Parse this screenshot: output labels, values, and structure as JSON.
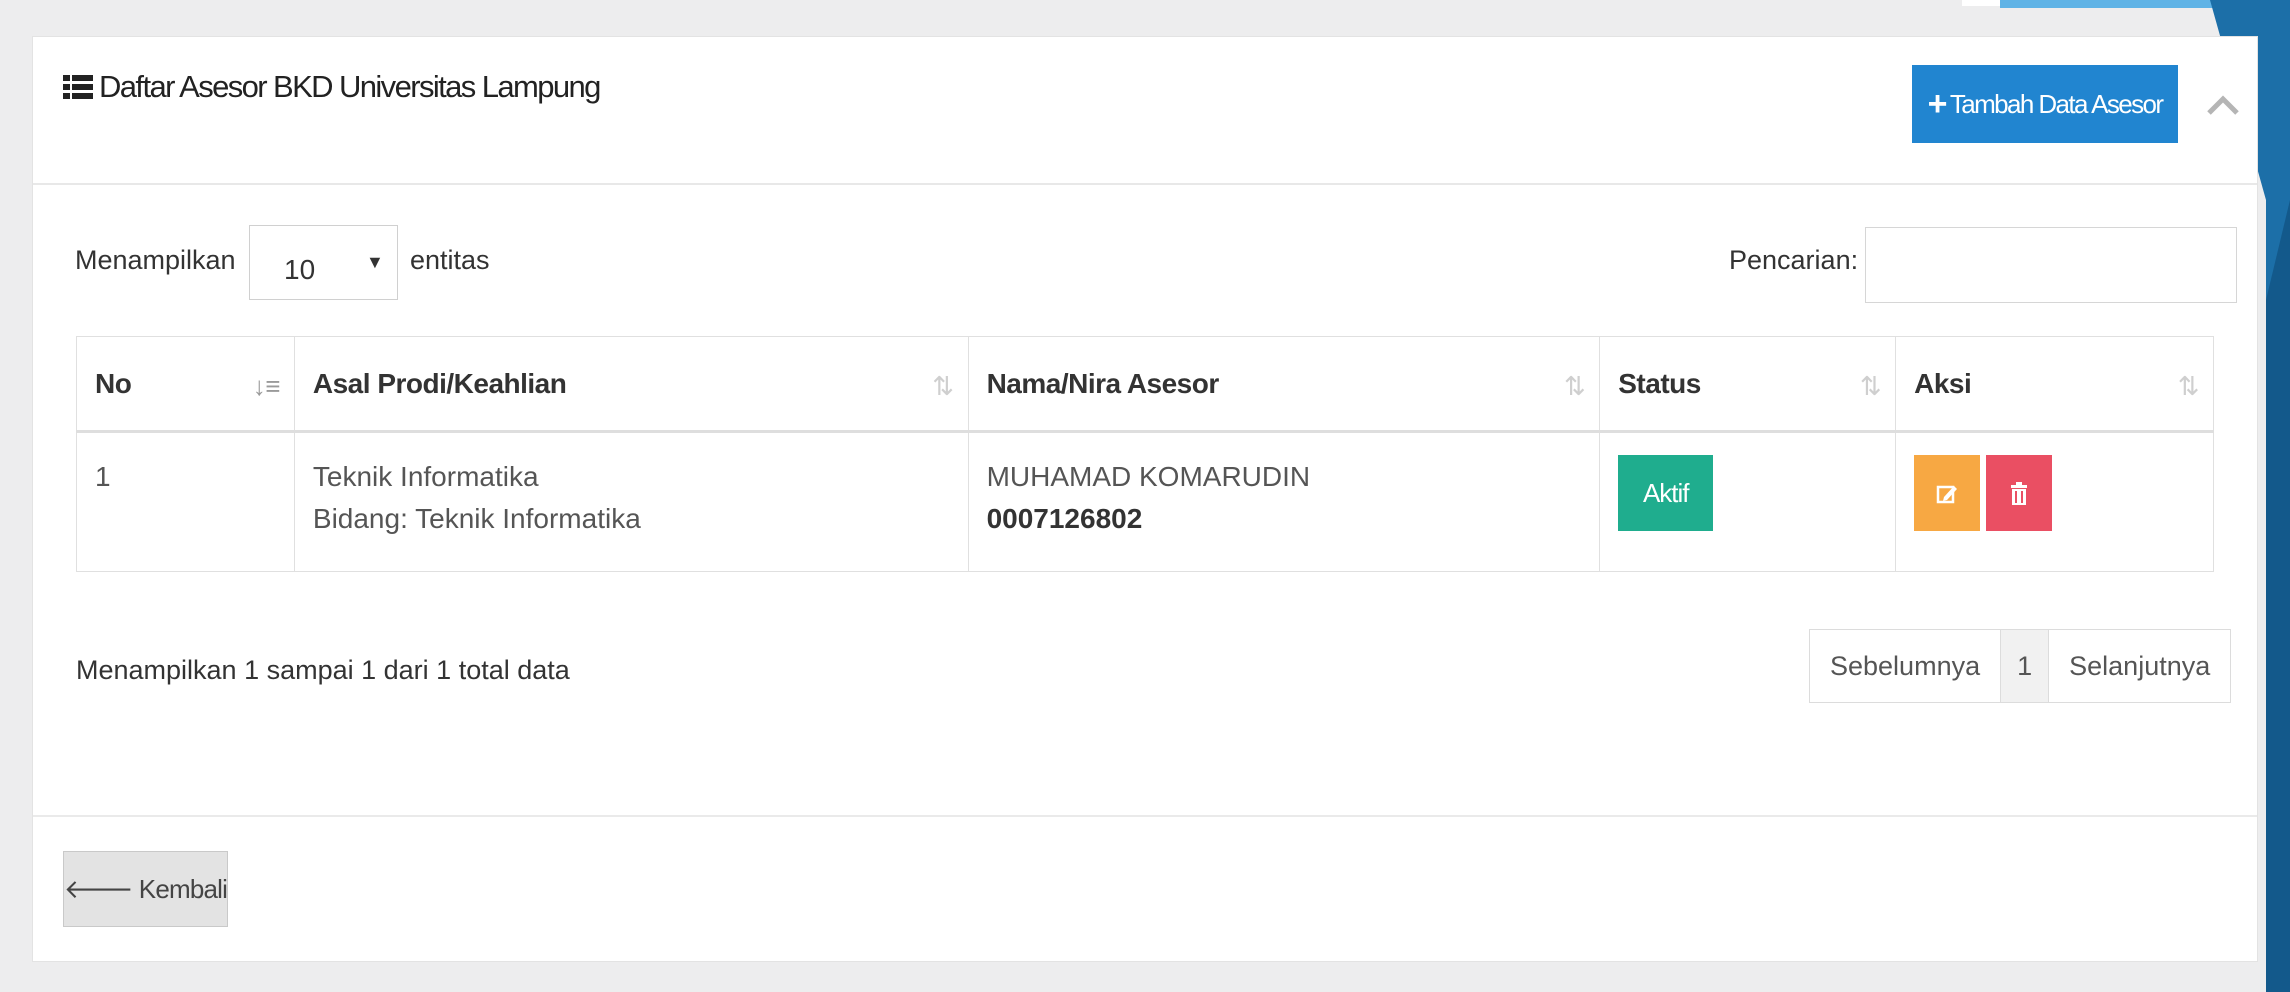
{
  "panel": {
    "title": "Daftar Asesor BKD Universitas Lampung",
    "add_button_label": "Tambah Data Asesor"
  },
  "controls": {
    "show_label": "Menampilkan",
    "page_size": "10",
    "entities_label": "entitas",
    "search_label": "Pencarian:",
    "search_value": ""
  },
  "table": {
    "headers": [
      "No",
      "Asal Prodi/Keahlian",
      "Nama/Nira Asesor",
      "Status",
      "Aksi"
    ],
    "rows": [
      {
        "no": "1",
        "prodi": "Teknik Informatika",
        "bidang": "Bidang: Teknik Informatika",
        "nama": "MUHAMAD KOMARUDIN",
        "nira": "0007126802",
        "status": "Aktif"
      }
    ]
  },
  "footer": {
    "info": "Menampilkan 1 sampai 1 dari 1 total data",
    "prev_label": "Sebelumnya",
    "page_number": "1",
    "next_label": "Selanjutnya",
    "back_label": "Kembali"
  },
  "icons": {
    "title_icon": "list-icon",
    "add_icon": "plus-icon",
    "collapse_icon": "chevron-up-icon",
    "select_icon": "caret-down-icon",
    "sort_icon": "sort-icon",
    "edit_icon": "edit-icon",
    "delete_icon": "trash-icon",
    "back_icon": "arrow-left-icon"
  },
  "colors": {
    "primary": "#2185d0",
    "success": "#1fad8e",
    "warning": "#f7a843",
    "danger": "#ea4f63"
  }
}
